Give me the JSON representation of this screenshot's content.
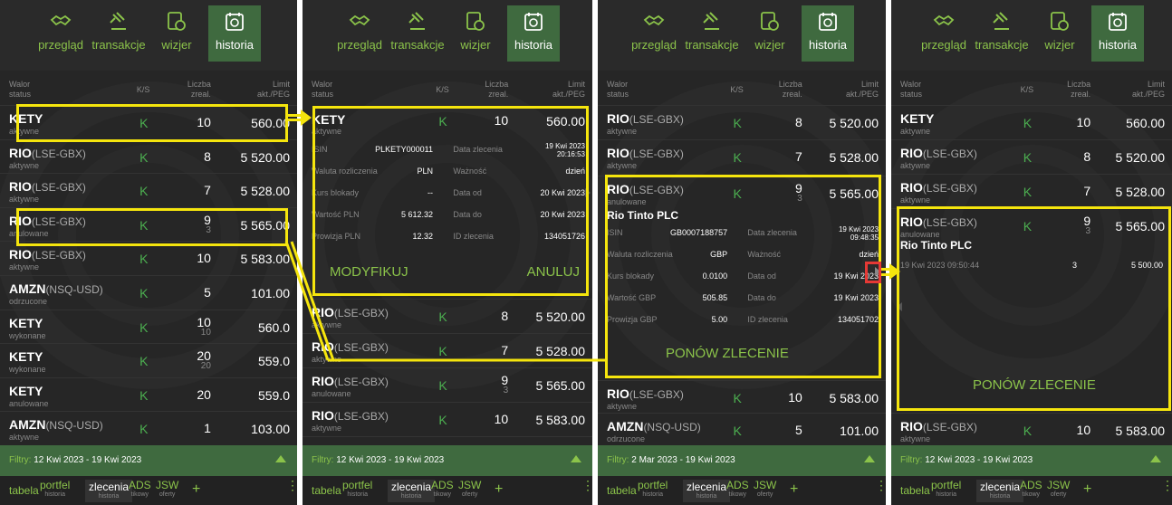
{
  "nav": {
    "przeglad": "przegląd",
    "transakcje": "transakcje",
    "wizjer": "wizjer",
    "historia": "historia"
  },
  "header": {
    "walor": "Walor",
    "status": "status",
    "ks": "K/S",
    "liczba": "Liczba",
    "zreal": "zreal.",
    "limit": "Limit",
    "aktpeg": "akt./PEG"
  },
  "panel1": {
    "rows": [
      {
        "ticker": "KETY",
        "market": "",
        "status": "aktywne",
        "ks": "K",
        "qty": "10",
        "sub": "",
        "limit": "560.00"
      },
      {
        "ticker": "RIO",
        "market": "(LSE-GBX)",
        "status": "aktywne",
        "ks": "K",
        "qty": "8",
        "sub": "",
        "limit": "5 520.00"
      },
      {
        "ticker": "RIO",
        "market": "(LSE-GBX)",
        "status": "aktywne",
        "ks": "K",
        "qty": "7",
        "sub": "",
        "limit": "5 528.00"
      },
      {
        "ticker": "RIO",
        "market": "(LSE-GBX)",
        "status": "anulowane",
        "ks": "K",
        "qty": "9",
        "sub": "3",
        "limit": "5 565.00"
      },
      {
        "ticker": "RIO",
        "market": "(LSE-GBX)",
        "status": "aktywne",
        "ks": "K",
        "qty": "10",
        "sub": "",
        "limit": "5 583.00"
      },
      {
        "ticker": "AMZN",
        "market": "(NSQ-USD)",
        "status": "odrzucone",
        "ks": "K",
        "qty": "5",
        "sub": "",
        "limit": "101.00"
      },
      {
        "ticker": "KETY",
        "market": "",
        "status": "wykonane",
        "ks": "K",
        "qty": "10",
        "sub": "10",
        "limit": "560.0"
      },
      {
        "ticker": "KETY",
        "market": "",
        "status": "wykonane",
        "ks": "K",
        "qty": "20",
        "sub": "20",
        "limit": "559.0"
      },
      {
        "ticker": "KETY",
        "market": "",
        "status": "anulowane",
        "ks": "K",
        "qty": "20",
        "sub": "",
        "limit": "559.0"
      },
      {
        "ticker": "AMZN",
        "market": "(NSQ-USD)",
        "status": "aktywne",
        "ks": "K",
        "qty": "1",
        "sub": "",
        "limit": "103.00"
      }
    ]
  },
  "panel2": {
    "detail": {
      "ticker": "KETY",
      "status": "aktywne",
      "ks": "K",
      "qty": "10",
      "limit": "560.00",
      "rows": [
        {
          "a": "ISIN",
          "b": "PLKETY000011",
          "c": "Data zlecenia",
          "d": "19 Kwi 2023",
          "d2": "20:16:53"
        },
        {
          "a": "Waluta rozliczenia",
          "b": "PLN",
          "c": "Ważność",
          "d": "dzień",
          "d2": ""
        },
        {
          "a": "Kurs blokady",
          "b": "--",
          "c": "Data od",
          "d": "20 Kwi 2023",
          "d2": ""
        },
        {
          "a": "Wartość PLN",
          "b": "5 612.32",
          "c": "Data do",
          "d": "20 Kwi 2023",
          "d2": ""
        },
        {
          "a": "Prowizja PLN",
          "b": "12.32",
          "c": "ID zlecenia",
          "d": "134051726",
          "d2": ""
        }
      ],
      "modify": "MODYFIKUJ",
      "cancel": "ANULUJ"
    },
    "rows": [
      {
        "ticker": "RIO",
        "market": "(LSE-GBX)",
        "status": "aktywne",
        "ks": "K",
        "qty": "8",
        "sub": "",
        "limit": "5 520.00"
      },
      {
        "ticker": "RIO",
        "market": "(LSE-GBX)",
        "status": "aktywne",
        "ks": "K",
        "qty": "7",
        "sub": "",
        "limit": "5 528.00"
      },
      {
        "ticker": "RIO",
        "market": "(LSE-GBX)",
        "status": "anulowane",
        "ks": "K",
        "qty": "9",
        "sub": "3",
        "limit": "5 565.00"
      },
      {
        "ticker": "RIO",
        "market": "(LSE-GBX)",
        "status": "aktywne",
        "ks": "K",
        "qty": "10",
        "sub": "",
        "limit": "5 583.00"
      },
      {
        "ticker": "AMZN",
        "market": "(NSQ-USD)",
        "status": "",
        "ks": "K",
        "qty": "5",
        "sub": "",
        "limit": "101.00"
      }
    ]
  },
  "panel3": {
    "rows_top": [
      {
        "ticker": "RIO",
        "market": "(LSE-GBX)",
        "status": "aktywne",
        "ks": "K",
        "qty": "8",
        "sub": "",
        "limit": "5 520.00"
      },
      {
        "ticker": "RIO",
        "market": "(LSE-GBX)",
        "status": "aktywne",
        "ks": "K",
        "qty": "7",
        "sub": "",
        "limit": "5 528.00"
      }
    ],
    "detail": {
      "ticker": "RIO",
      "market": "(LSE-GBX)",
      "status": "anulowane",
      "ks": "K",
      "qty": "9",
      "sub": "3",
      "limit": "5 565.00",
      "name": "Rio Tinto PLC",
      "rows": [
        {
          "a": "ISIN",
          "b": "GB0007188757",
          "c": "Data zlecenia",
          "d": "19 Kwi 2023",
          "d2": "09:48:35"
        },
        {
          "a": "Waluta rozliczenia",
          "b": "GBP",
          "c": "Ważność",
          "d": "dzień",
          "d2": ""
        },
        {
          "a": "Kurs blokady",
          "b": "0.0100",
          "c": "Data od",
          "d": "19 Kwi 2023",
          "d2": ""
        },
        {
          "a": "Wartość GBP",
          "b": "505.85",
          "c": "Data do",
          "d": "19 Kwi 2023",
          "d2": ""
        },
        {
          "a": "Prowizja GBP",
          "b": "5.00",
          "c": "ID zlecenia",
          "d": "134051702",
          "d2": ""
        }
      ],
      "repeat": "PONÓW ZLECENIE"
    },
    "rows_bottom": [
      {
        "ticker": "RIO",
        "market": "(LSE-GBX)",
        "status": "aktywne",
        "ks": "K",
        "qty": "10",
        "sub": "",
        "limit": "5 583.00"
      },
      {
        "ticker": "AMZN",
        "market": "(NSQ-USD)",
        "status": "odrzucone",
        "ks": "K",
        "qty": "5",
        "sub": "",
        "limit": "101.00"
      }
    ]
  },
  "panel4": {
    "rows_top": [
      {
        "ticker": "KETY",
        "market": "",
        "status": "aktywne",
        "ks": "K",
        "qty": "10",
        "sub": "",
        "limit": "560.00"
      },
      {
        "ticker": "RIO",
        "market": "(LSE-GBX)",
        "status": "aktywne",
        "ks": "K",
        "qty": "8",
        "sub": "",
        "limit": "5 520.00"
      },
      {
        "ticker": "RIO",
        "market": "(LSE-GBX)",
        "status": "aktywne",
        "ks": "K",
        "qty": "7",
        "sub": "",
        "limit": "5 528.00"
      }
    ],
    "detail": {
      "ticker": "RIO",
      "market": "(LSE-GBX)",
      "status": "anulowane",
      "ks": "K",
      "qty": "9",
      "sub": "3",
      "limit": "5 565.00",
      "name": "Rio Tinto PLC",
      "exec_date": "19 Kwi 2023 09:50:44",
      "exec_qty": "3",
      "exec_price": "5 500.00",
      "repeat": "PONÓW ZLECENIE"
    },
    "rows_bottom": [
      {
        "ticker": "RIO",
        "market": "(LSE-GBX)",
        "status": "aktywne",
        "ks": "K",
        "qty": "10",
        "sub": "",
        "limit": "5 583.00"
      }
    ]
  },
  "filters": {
    "label": "Filtry:",
    "p1": "12 Kwi 2023 - 19 Kwi 2023",
    "p2": "12 Kwi 2023 - 19 Kwi 2023",
    "p3": "2 Mar 2023 - 19 Kwi 2023",
    "p4": "12 Kwi 2023 - 19 Kwi 2023"
  },
  "bottom_tabs": {
    "tabela": "tabela",
    "portfel": "portfel",
    "portfel_sub": "historia",
    "zlecenia": "zlecenia",
    "zlecenia_sub": "historia",
    "ads": "ADS",
    "ads_sub": "tikowy",
    "jsw": "JSW",
    "jsw_sub": "oferty",
    "plus": "+",
    "more": "⋮"
  },
  "colors": {
    "accent": "#8bc34a",
    "active": "#3f6a3f",
    "bg": "#262626",
    "highlight": "#f5e50d",
    "red": "#e53935"
  }
}
